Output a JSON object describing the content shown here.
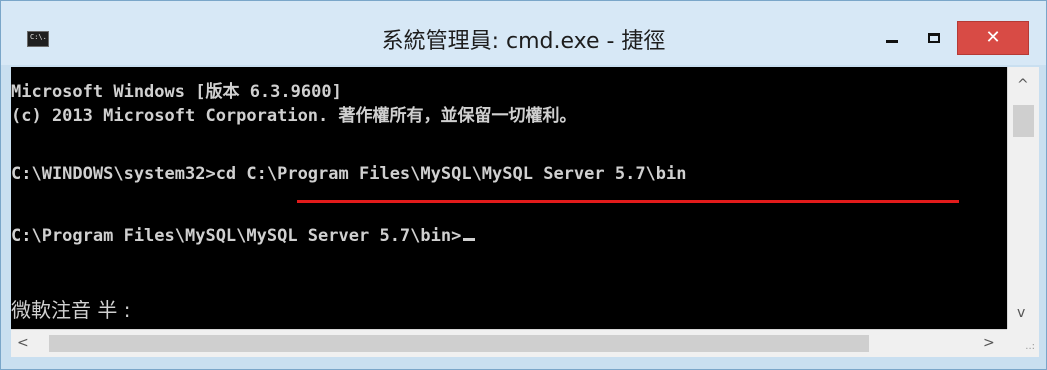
{
  "window": {
    "title": "系統管理員: cmd.exe - 捷徑",
    "icon_name": "console-app-icon",
    "icon_text": "C:\\.",
    "close_glyph": "✕",
    "colors": {
      "titlebar": "#d7e8f6",
      "close_button": "#d84b45",
      "console_bg": "#000000",
      "console_text": "#d0d0d0",
      "highlight_underline": "#e21b1b"
    }
  },
  "console": {
    "lines": [
      "Microsoft Windows [版本 6.3.9600]",
      "(c) 2013 Microsoft Corporation. 著作權所有，並保留一切權利。",
      "C:\\WINDOWS\\system32>cd C:\\Program Files\\MySQL\\MySQL Server 5.7\\bin",
      "C:\\Program Files\\MySQL\\MySQL Server 5.7\\bin>",
      "微軟注音 半 :"
    ]
  },
  "scrollbars": {
    "up": "^",
    "down": "v",
    "left": "<",
    "right": ">",
    "grip": "..:"
  }
}
